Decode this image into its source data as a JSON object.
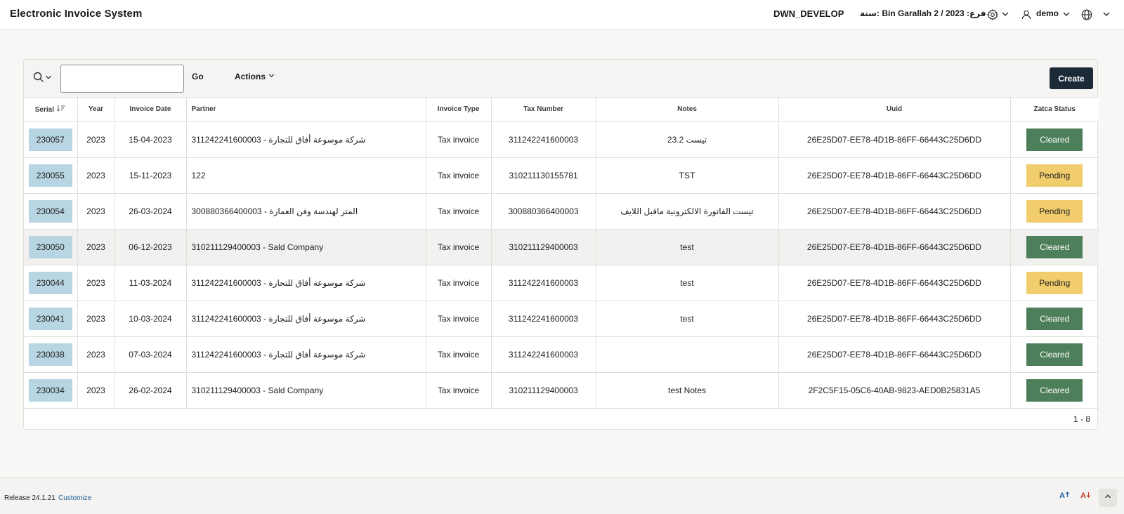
{
  "header": {
    "app_title": "Electronic Invoice System",
    "environment": "DWN_DEVELOP",
    "branch_info": "فرع: Bin Garallah 2 / 2023 :سنة",
    "user": "demo",
    "icons": [
      "gear-icon",
      "user-icon",
      "globe-icon"
    ]
  },
  "toolbar": {
    "search_value": "",
    "go_label": "Go",
    "actions_label": "Actions",
    "create_label": "Create"
  },
  "table": {
    "columns": [
      "Serial",
      "Year",
      "Invoice Date",
      "Partner",
      "Invoice Type",
      "Tax Number",
      "Notes",
      "Uuid",
      "Zatca Status"
    ],
    "sort_column": "Serial",
    "sort_direction": "descending",
    "rows": [
      {
        "serial": "230057",
        "year": "2023",
        "date": "15-04-2023",
        "partner": "311242241600003 - شركة موسوعة أفاق للتجارة",
        "type": "Tax invoice",
        "tax": "311242241600003",
        "notes": "تيست 23.2",
        "uuid": "26E25D07-EE78-4D1B-86FF-66443C25D6DD",
        "status": "Cleared"
      },
      {
        "serial": "230055",
        "year": "2023",
        "date": "15-11-2023",
        "partner": "122",
        "type": "Tax invoice",
        "tax": "310211130155781",
        "notes": "TST",
        "uuid": "26E25D07-EE78-4D1B-86FF-66443C25D6DD",
        "status": "Pending"
      },
      {
        "serial": "230054",
        "year": "2023",
        "date": "26-03-2024",
        "partner": "300880366400003 - المتر لهندسة وفن العمارة",
        "type": "Tax invoice",
        "tax": "300880366400003",
        "notes": "تيست الفاتورة الالكترونية ماقبل اللايف",
        "uuid": "26E25D07-EE78-4D1B-86FF-66443C25D6DD",
        "status": "Pending"
      },
      {
        "serial": "230050",
        "year": "2023",
        "date": "06-12-2023",
        "partner": "310211129400003 - Sald Company",
        "type": "Tax invoice",
        "tax": "310211129400003",
        "notes": "test",
        "uuid": "26E25D07-EE78-4D1B-86FF-66443C25D6DD",
        "status": "Cleared"
      },
      {
        "serial": "230044",
        "year": "2023",
        "date": "11-03-2024",
        "partner": "311242241600003 - شركة موسوعة أفاق للتجارة",
        "type": "Tax invoice",
        "tax": "311242241600003",
        "notes": "test",
        "uuid": "26E25D07-EE78-4D1B-86FF-66443C25D6DD",
        "status": "Pending"
      },
      {
        "serial": "230041",
        "year": "2023",
        "date": "10-03-2024",
        "partner": "311242241600003 - شركة موسوعة أفاق للتجارة",
        "type": "Tax invoice",
        "tax": "311242241600003",
        "notes": "test",
        "uuid": "26E25D07-EE78-4D1B-86FF-66443C25D6DD",
        "status": "Cleared"
      },
      {
        "serial": "230038",
        "year": "2023",
        "date": "07-03-2024",
        "partner": "311242241600003 - شركة موسوعة أفاق للتجارة",
        "type": "Tax invoice",
        "tax": "311242241600003",
        "notes": "",
        "uuid": "26E25D07-EE78-4D1B-86FF-66443C25D6DD",
        "status": "Cleared"
      },
      {
        "serial": "230034",
        "year": "2023",
        "date": "26-02-2024",
        "partner": "310211129400003 - Sald Company",
        "type": "Tax invoice",
        "tax": "310211129400003",
        "notes": "test Notes",
        "uuid": "2F2C5F15-05C6-40AB-9823-AED0B25831A5",
        "status": "Cleared"
      }
    ],
    "pagination": "1 - 8"
  },
  "status_colors": {
    "Cleared": "#4d7f5a",
    "Pending": "#f1cd6d",
    "serial_badge": "#b7d5e2",
    "create_button": "#1c2a38"
  },
  "footer": {
    "release": "Release 24.1.21",
    "customize": "Customize",
    "font_increase_icon": "font-increase-icon",
    "font_decrease_icon": "font-decrease-icon",
    "scroll_top_icon": "chevron-up-icon"
  }
}
